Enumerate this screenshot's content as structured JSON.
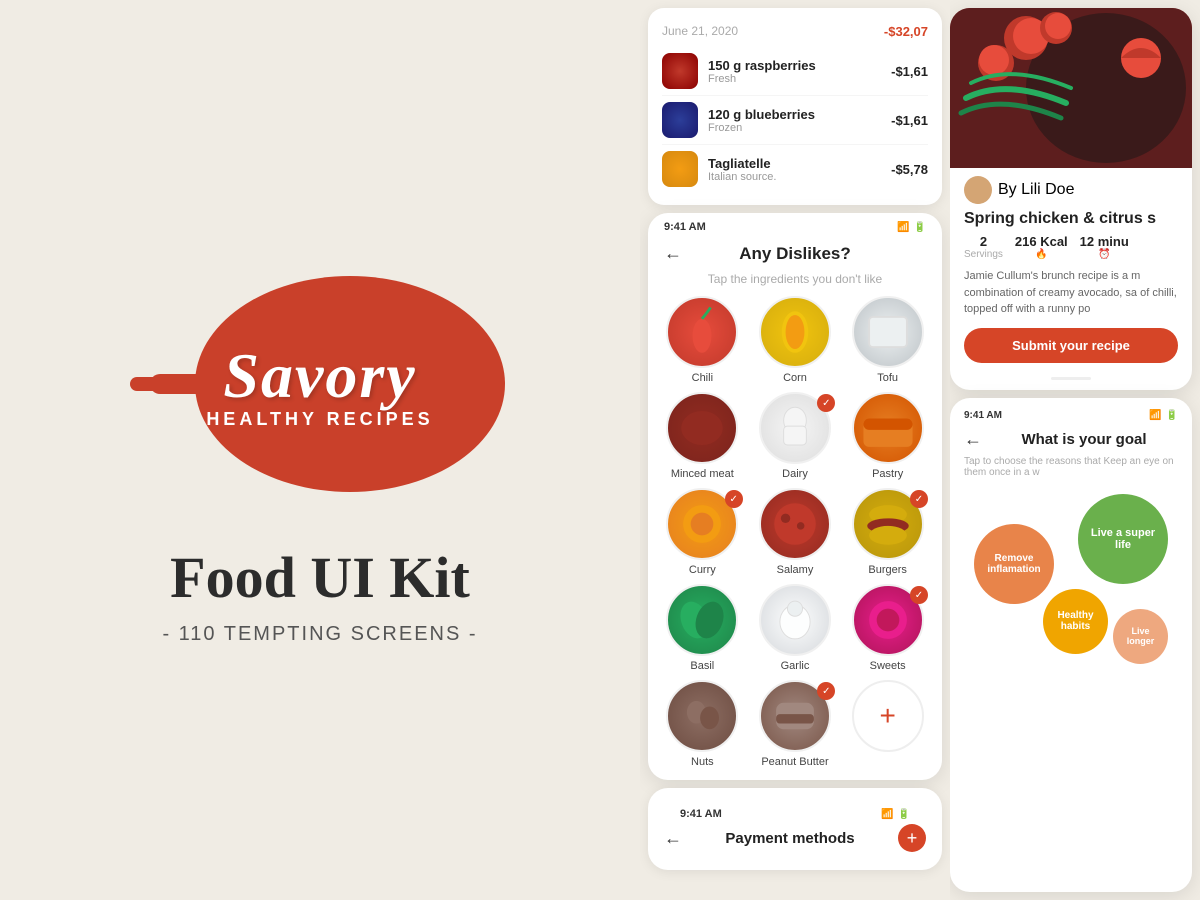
{
  "app": {
    "name": "Savory",
    "tagline": "HEALTHY RECIPES",
    "kit_name": "Food UI Kit",
    "screens_count": "- 110 TEMPTING SCREENS -"
  },
  "receipt": {
    "date": "June 21, 2020",
    "total": "-$32,07",
    "items": [
      {
        "name": "150 g raspberries",
        "sub": "Fresh",
        "price": "-$1,61",
        "color": "food-raspberry"
      },
      {
        "name": "120 g blueberries",
        "sub": "Frozen",
        "price": "-$1,61",
        "color": "food-blueberry"
      },
      {
        "name": "Tagliatelle",
        "sub": "Italian source.",
        "price": "-$5,78",
        "color": "food-tagliatelle"
      }
    ]
  },
  "dislikes": {
    "title": "Any Dislikes?",
    "subtitle": "Tap the ingredients you don't like",
    "time": "9:41 AM",
    "ingredients": [
      {
        "name": "Chili",
        "selected": false,
        "color": "food-chili"
      },
      {
        "name": "Corn",
        "selected": false,
        "color": "food-corn"
      },
      {
        "name": "Tofu",
        "selected": false,
        "color": "food-tofu"
      },
      {
        "name": "Minced meat",
        "selected": false,
        "color": "food-meat"
      },
      {
        "name": "Dairy",
        "selected": true,
        "color": "food-dairy"
      },
      {
        "name": "Pastry",
        "selected": false,
        "color": "food-pastry"
      },
      {
        "name": "Curry",
        "selected": true,
        "color": "food-curry"
      },
      {
        "name": "Salamy",
        "selected": false,
        "color": "food-salami"
      },
      {
        "name": "Burgers",
        "selected": true,
        "color": "food-burger"
      },
      {
        "name": "Basil",
        "selected": false,
        "color": "food-basil"
      },
      {
        "name": "Garlic",
        "selected": false,
        "color": "food-garlic"
      },
      {
        "name": "Sweets",
        "selected": true,
        "color": "food-sweets"
      },
      {
        "name": "Nuts",
        "selected": false,
        "color": "food-nuts"
      },
      {
        "name": "Peanut Butter",
        "selected": true,
        "color": "food-peanut"
      }
    ]
  },
  "payment": {
    "time": "9:41 AM",
    "title": "Payment methods"
  },
  "recipe": {
    "author": "By Lili Doe",
    "title": "Spring chicken & citrus s",
    "servings": "2",
    "servings_label": "Servings",
    "kcal": "216 Kcal",
    "time": "12 minu",
    "desc": "Jamie Cullum's brunch recipe is a m combination of creamy avocado, sa of chilli, topped off with a runny po",
    "submit_label": "Submit your recipe"
  },
  "goals": {
    "time": "9:41 AM",
    "title": "What is your goal",
    "subtitle": "Tap to choose the reasons that  Keep an eye on them once in a w",
    "bubbles": [
      {
        "label": "Live a super life",
        "color": "green",
        "size": 90
      },
      {
        "label": "Remove inflamation",
        "color": "orange",
        "size": 80
      },
      {
        "label": "Healthy habits",
        "color": "yellow",
        "size": 65
      },
      {
        "label": "Live longer",
        "color": "orange-light",
        "size": 55
      }
    ]
  },
  "icons": {
    "back_arrow": "←",
    "add_plus": "+",
    "check": "✓"
  }
}
